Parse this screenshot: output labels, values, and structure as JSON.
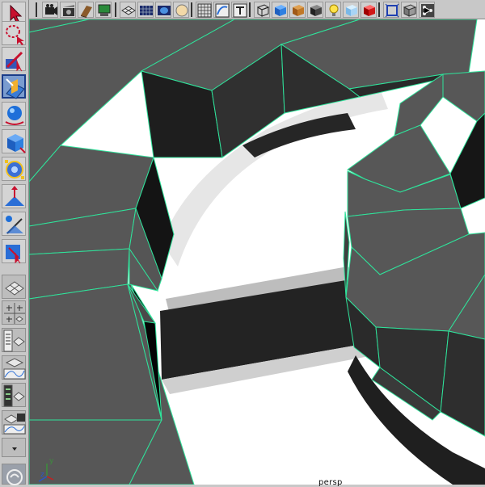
{
  "app": {
    "viewport_camera_label": "persp",
    "axis_labels": {
      "y": "y",
      "z": "z"
    }
  },
  "toolbox": {
    "tools": [
      {
        "name": "select-tool-icon",
        "active": false
      },
      {
        "name": "lasso-tool-icon",
        "active": false
      },
      {
        "name": "paint-select-tool-icon",
        "active": false
      },
      {
        "name": "move-tool-icon",
        "active": true
      },
      {
        "name": "rotate-tool-icon",
        "active": false
      },
      {
        "name": "scale-tool-icon",
        "active": false
      },
      {
        "name": "universal-manipulator-icon",
        "active": false
      },
      {
        "name": "soft-modification-icon",
        "active": false
      },
      {
        "name": "show-manipulator-icon",
        "active": false
      },
      {
        "name": "last-tool-used-icon",
        "active": false
      }
    ],
    "layouts": [
      {
        "name": "single-pane-layout-icon"
      },
      {
        "name": "four-pane-layout-icon"
      },
      {
        "name": "outliner-persp-layout-icon"
      },
      {
        "name": "graph-editor-persp-layout-icon"
      },
      {
        "name": "hypershade-persp-layout-icon"
      },
      {
        "name": "uv-editor-layout-icon"
      },
      {
        "name": "more-layouts-icon"
      },
      {
        "name": "script-editor-icon"
      }
    ]
  },
  "shelf": {
    "icons": [
      "camera-icon",
      "film-clapper-icon",
      "texture-book-icon",
      "render-settings-icon",
      "wireframe-icon",
      "grid-icon",
      "uv-icon",
      "sphere-icon",
      "snap-grid-icon",
      "snap-curve-icon",
      "text-icon",
      "cube-wireframe-icon",
      "blue-cube-icon",
      "wood-box-icon",
      "camera-box-icon",
      "light-bulb-icon",
      "ice-cube-icon",
      "red-cube-icon",
      "select-frame-icon",
      "isolate-cube-icon",
      "hierarchy-icon"
    ]
  },
  "colors": {
    "wire": "#2fe39b",
    "face_top": "#575757",
    "face_side_dark": "#1d1d1d",
    "face_side_mid": "#333333",
    "shadow": "#242424",
    "ui_bg": "#c8c8c8",
    "viewport_bg": "#ffffff"
  }
}
